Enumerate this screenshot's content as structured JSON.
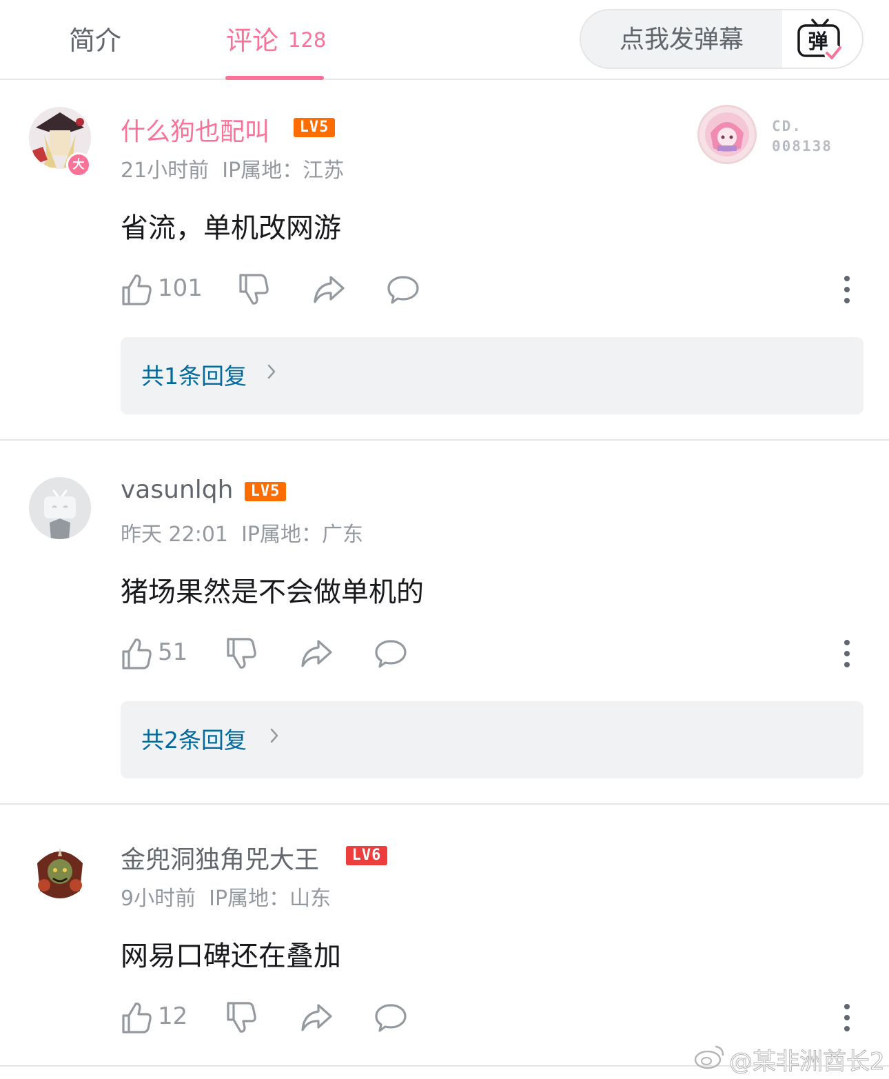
{
  "tabs": {
    "intro_label": "简介",
    "comments_label": "评论",
    "comments_count": "128"
  },
  "danmaku": {
    "placeholder": "点我发弹幕",
    "toggle_glyph": "弹"
  },
  "colors": {
    "accent_pink": "#fb7299",
    "reply_link_blue": "#00699d",
    "level_orange": "#ff6c00",
    "level_red": "#ee3d3d"
  },
  "comments": [
    {
      "username": "什么狗也配叫",
      "level": "LV5",
      "vip_badge": "大",
      "time": "21小时前",
      "ip": "IP属地：江苏",
      "text": "省流，单机改网游",
      "likes": "101",
      "replies_label": "共1条回复",
      "fan_badge_code": "CD.",
      "fan_badge_number": "008138"
    },
    {
      "username": "vasunlqh",
      "level": "LV5",
      "time": "昨天 22:01",
      "ip": "IP属地：广东",
      "text": "猪场果然是不会做单机的",
      "likes": "51",
      "replies_label": "共2条回复"
    },
    {
      "username": "金兜洞独角兕大王",
      "level": "LV6",
      "time": "9小时前",
      "ip": "IP属地：山东",
      "text": "网易口碑还在叠加",
      "likes": "12"
    }
  ],
  "icons": {
    "like": "thumb-up-icon",
    "dislike": "thumb-down-icon",
    "share": "share-icon",
    "reply": "chat-bubble-icon",
    "more": "more-vertical-icon",
    "chevron": "chevron-right-icon"
  },
  "watermark": "@某非洲酋长2"
}
